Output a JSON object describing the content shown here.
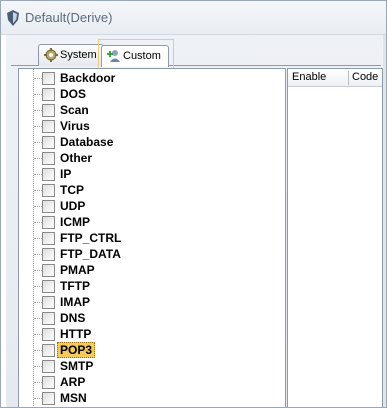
{
  "window": {
    "title": "Default(Derive)",
    "icon": "shield-icon"
  },
  "tabs": [
    {
      "label": "System",
      "icon": "gear-icon",
      "active": false
    },
    {
      "label": "Custom",
      "icon": "add-user-icon",
      "active": true
    }
  ],
  "tree": {
    "items": [
      {
        "label": "Backdoor",
        "checked": false
      },
      {
        "label": "DOS",
        "checked": false
      },
      {
        "label": "Scan",
        "checked": false
      },
      {
        "label": "Virus",
        "checked": false
      },
      {
        "label": "Database",
        "checked": false
      },
      {
        "label": "Other",
        "checked": false
      },
      {
        "label": "IP",
        "checked": false
      },
      {
        "label": "TCP",
        "checked": false
      },
      {
        "label": "UDP",
        "checked": false
      },
      {
        "label": "ICMP",
        "checked": false
      },
      {
        "label": "FTP_CTRL",
        "checked": false
      },
      {
        "label": "FTP_DATA",
        "checked": false
      },
      {
        "label": "PMAP",
        "checked": false
      },
      {
        "label": "TFTP",
        "checked": false
      },
      {
        "label": "IMAP",
        "checked": false
      },
      {
        "label": "DNS",
        "checked": false
      },
      {
        "label": "HTTP",
        "checked": false
      },
      {
        "label": "POP3",
        "checked": false,
        "selected": true
      },
      {
        "label": "SMTP",
        "checked": false
      },
      {
        "label": "ARP",
        "checked": false
      },
      {
        "label": "MSN",
        "checked": false
      }
    ]
  },
  "grid": {
    "columns": [
      "Enable",
      "Code"
    ]
  },
  "colors": {
    "selection": "#f6c95c",
    "tab_focus_border": "#f2c97a",
    "title_text": "#5a6a7e"
  }
}
